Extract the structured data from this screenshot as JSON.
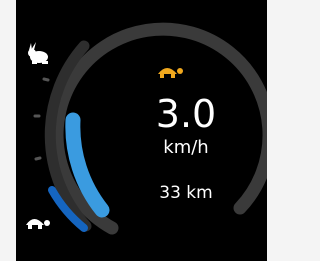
{
  "speed": {
    "value": "3.0",
    "unit": "km/h"
  },
  "distance": {
    "label": "33 km"
  },
  "assist_level": {
    "fraction": 0.38
  },
  "colors": {
    "accent": "#3a9be0",
    "accent_dark": "#1565c0",
    "track": "#3a3a3a",
    "eco_icon": "#f0a81e",
    "background": "#000000"
  },
  "icons": {
    "fast_mode": "rabbit-icon",
    "slow_mode": "turtle-icon",
    "eco_mode": "turtle-icon"
  }
}
